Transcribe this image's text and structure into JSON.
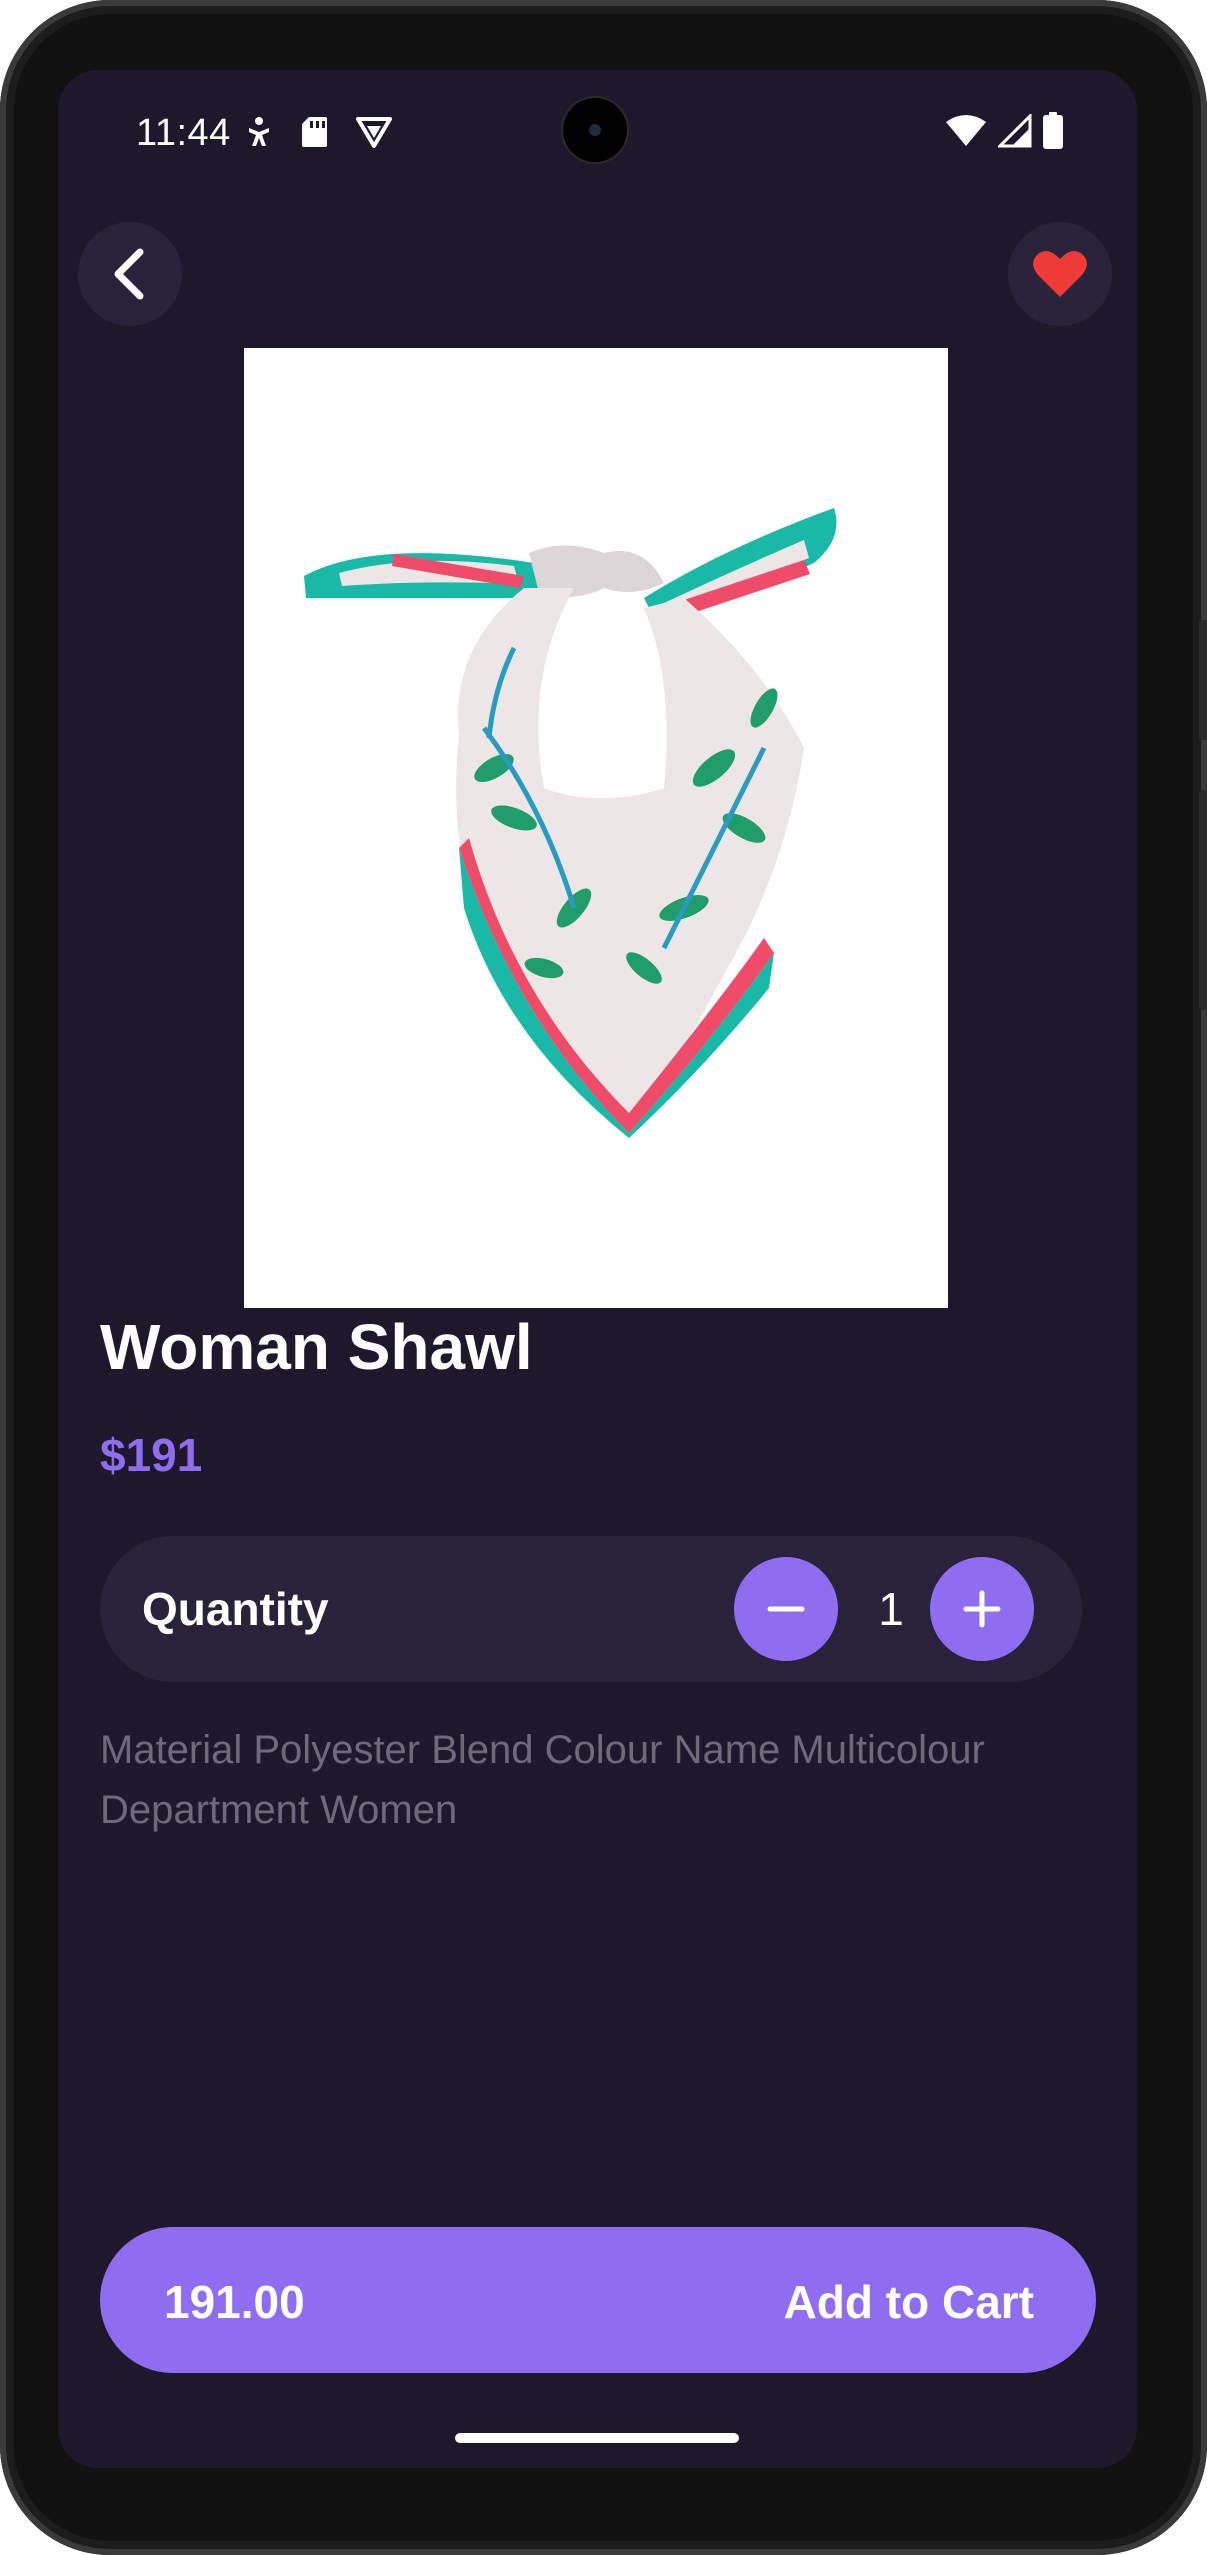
{
  "status_bar": {
    "time": "11:44",
    "left_icons": [
      "accessibility-icon",
      "sd-card-icon",
      "vpn-shield-icon"
    ],
    "right_icons": [
      "wifi-icon",
      "signal-icon",
      "battery-icon"
    ]
  },
  "header": {
    "back_icon": "chevron-left-icon",
    "favorite_icon": "heart-icon",
    "favorite_color": "#ef3b36"
  },
  "product": {
    "image": "shawl-image",
    "name": "Woman Shawl",
    "price": "$191",
    "description": "Material Polyester Blend Colour Name Multicolour Department Women"
  },
  "quantity": {
    "label": "Quantity",
    "value": "1",
    "decrease_icon": "minus-icon",
    "increase_icon": "plus-icon"
  },
  "cart": {
    "total": "191.00",
    "button_label": "Add to Cart"
  },
  "colors": {
    "background": "#1d182b",
    "surface": "#28223a",
    "accent": "#8f6df0",
    "muted_text": "#6f6a7a"
  }
}
